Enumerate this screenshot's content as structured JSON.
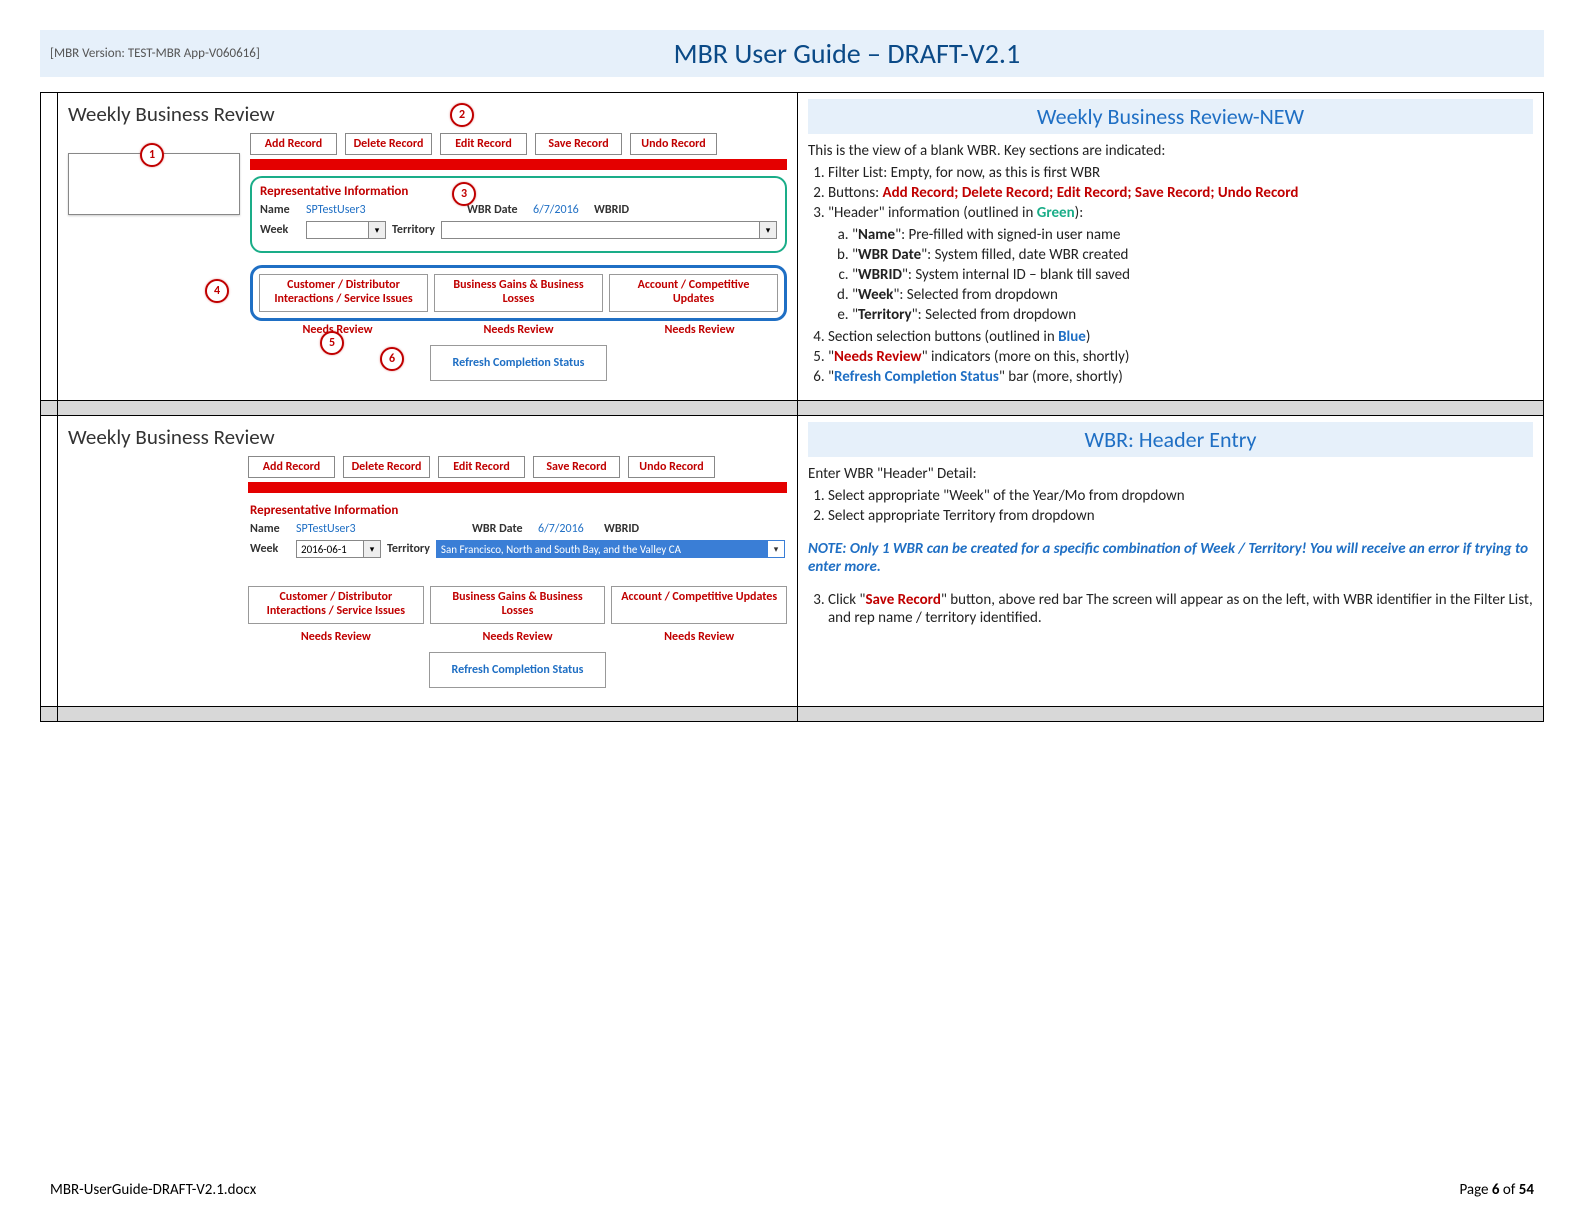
{
  "header": {
    "version": "[MBR Version: TEST-MBR App-V060616]",
    "title": "MBR User Guide – DRAFT-V2.1"
  },
  "r1": {
    "app_title": "Weekly Business Review",
    "buttons": [
      "Add Record",
      "Delete Record",
      "Edit Record",
      "Save Record",
      "Undo Record"
    ],
    "rep": {
      "title": "Representative Information",
      "name_label": "Name",
      "name_value": "SPTestUser3",
      "wbrdate_label": "WBR Date",
      "wbrdate_value": "6/7/2016",
      "wbrid_label": "WBRID",
      "week_label": "Week",
      "week_value": "",
      "territory_label": "Territory",
      "territory_value": ""
    },
    "sections": [
      "Customer / Distributor Interactions / Service Issues",
      "Business Gains & Business Losses",
      "Account / Competitive Updates"
    ],
    "needs_review": "Needs Review",
    "refresh": "Refresh Completion Status",
    "badges": [
      "1",
      "2",
      "3",
      "4",
      "5",
      "6"
    ],
    "right": {
      "title": "Weekly Business Review-NEW",
      "intro": "This is the view of a blank WBR. Key sections are indicated:",
      "items": {
        "i1": "Filter List: Empty, for now, as this is first WBR",
        "i2_pre": "Buttons: ",
        "i2_btns": "Add Record; Delete Record; Edit Record; Save Record; Undo Record",
        "i3_pre": "\"Header\" information (outlined in ",
        "i3_green": "Green",
        "i3_post": "):",
        "i3a_pre": "\"",
        "i3a_b": "Name",
        "i3a_post": "\": Pre-filled with signed-in user name",
        "i3b_pre": "\"",
        "i3b_b": "WBR Date",
        "i3b_post": "\": System filled, date WBR created",
        "i3c_pre": "\"",
        "i3c_b": "WBRID",
        "i3c_post": "\": System internal ID – blank till saved",
        "i3d_pre": "\"",
        "i3d_b": "Week",
        "i3d_post": "\": Selected from dropdown",
        "i3e_pre": "\"",
        "i3e_b": "Territory",
        "i3e_post": "\": Selected from dropdown",
        "i4_pre": "Section selection buttons (outlined in ",
        "i4_blue": "Blue",
        "i4_post": ")",
        "i5_pre": "\"",
        "i5_red": "Needs Review",
        "i5_post": "\" indicators (more on this, shortly)",
        "i6_pre": "\"",
        "i6_blue": "Refresh Completion Status",
        "i6_post": "\" bar (more, shortly)"
      }
    }
  },
  "r2": {
    "app_title": "Weekly Business Review",
    "buttons": [
      "Add Record",
      "Delete Record",
      "Edit Record",
      "Save Record",
      "Undo Record"
    ],
    "rep": {
      "title": "Representative Information",
      "name_label": "Name",
      "name_value": "SPTestUser3",
      "wbrdate_label": "WBR Date",
      "wbrdate_value": "6/7/2016",
      "wbrid_label": "WBRID",
      "week_label": "Week",
      "week_value": "2016-06-1",
      "territory_label": "Territory",
      "territory_value": "San Francisco, North and South Bay, and the Valley CA"
    },
    "sections": [
      "Customer / Distributor Interactions / Service Issues",
      "Business Gains & Business Losses",
      "Account / Competitive Updates"
    ],
    "needs_review": "Needs Review",
    "refresh": "Refresh Completion Status",
    "right": {
      "title": "WBR: Header Entry",
      "intro": "Enter WBR \"Header\" Detail:",
      "i1": "Select appropriate \"Week\" of the Year/Mo from dropdown",
      "i2": "Select appropriate Territory from dropdown",
      "note": "NOTE: Only 1 WBR can be created for a specific combination of Week / Territory! You will receive an error if trying to enter more.",
      "i3_pre": "Click \"",
      "i3_red": "Save Record",
      "i3_post": "\" button, above red bar The screen will appear as on the left, with WBR identifier in the Filter List, and rep name / territory identified."
    }
  },
  "footer": {
    "file": "MBR-UserGuide-DRAFT-V2.1.docx",
    "page_pre": "Page ",
    "page_num": "6",
    "page_of": " of ",
    "page_total": "54"
  }
}
